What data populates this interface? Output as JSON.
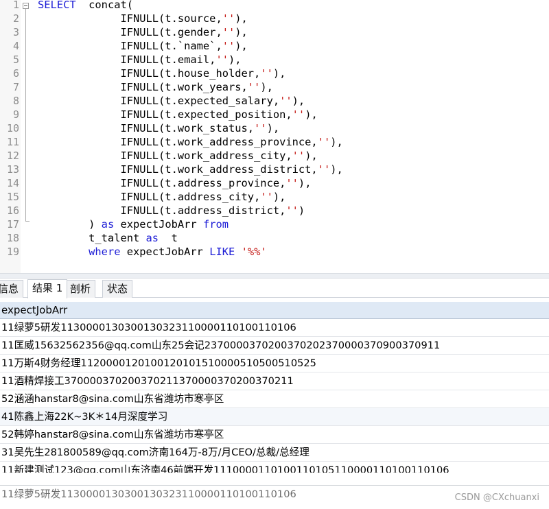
{
  "editor": {
    "lines": [
      {
        "num": "1",
        "segments": [
          {
            "t": "SELECT",
            "c": "kw"
          },
          {
            "t": "  concat(",
            "c": ""
          }
        ]
      },
      {
        "num": "2",
        "segments": [
          {
            "t": "             IFNULL(t.source,",
            "c": ""
          },
          {
            "t": "''",
            "c": "str"
          },
          {
            "t": "),",
            "c": ""
          }
        ]
      },
      {
        "num": "3",
        "segments": [
          {
            "t": "             IFNULL(t.gender,",
            "c": ""
          },
          {
            "t": "''",
            "c": "str"
          },
          {
            "t": "),",
            "c": ""
          }
        ]
      },
      {
        "num": "4",
        "segments": [
          {
            "t": "             IFNULL(t.`name`,",
            "c": ""
          },
          {
            "t": "''",
            "c": "str"
          },
          {
            "t": "),",
            "c": ""
          }
        ]
      },
      {
        "num": "5",
        "segments": [
          {
            "t": "             IFNULL(t.email,",
            "c": ""
          },
          {
            "t": "''",
            "c": "str"
          },
          {
            "t": "),",
            "c": ""
          }
        ]
      },
      {
        "num": "6",
        "segments": [
          {
            "t": "             IFNULL(t.house_holder,",
            "c": ""
          },
          {
            "t": "''",
            "c": "str"
          },
          {
            "t": "),",
            "c": ""
          }
        ]
      },
      {
        "num": "7",
        "segments": [
          {
            "t": "             IFNULL(t.work_years,",
            "c": ""
          },
          {
            "t": "''",
            "c": "str"
          },
          {
            "t": "),",
            "c": ""
          }
        ]
      },
      {
        "num": "8",
        "segments": [
          {
            "t": "             IFNULL(t.expected_salary,",
            "c": ""
          },
          {
            "t": "''",
            "c": "str"
          },
          {
            "t": "),",
            "c": ""
          }
        ]
      },
      {
        "num": "9",
        "segments": [
          {
            "t": "             IFNULL(t.expected_position,",
            "c": ""
          },
          {
            "t": "''",
            "c": "str"
          },
          {
            "t": "),",
            "c": ""
          }
        ]
      },
      {
        "num": "10",
        "segments": [
          {
            "t": "             IFNULL(t.work_status,",
            "c": ""
          },
          {
            "t": "''",
            "c": "str"
          },
          {
            "t": "),",
            "c": ""
          }
        ]
      },
      {
        "num": "11",
        "segments": [
          {
            "t": "             IFNULL(t.work_address_province,",
            "c": ""
          },
          {
            "t": "''",
            "c": "str"
          },
          {
            "t": "),",
            "c": ""
          }
        ]
      },
      {
        "num": "12",
        "segments": [
          {
            "t": "             IFNULL(t.work_address_city,",
            "c": ""
          },
          {
            "t": "''",
            "c": "str"
          },
          {
            "t": "),",
            "c": ""
          }
        ]
      },
      {
        "num": "13",
        "segments": [
          {
            "t": "             IFNULL(t.work_address_district,",
            "c": ""
          },
          {
            "t": "''",
            "c": "str"
          },
          {
            "t": "),",
            "c": ""
          }
        ]
      },
      {
        "num": "14",
        "segments": [
          {
            "t": "             IFNULL(t.address_province,",
            "c": ""
          },
          {
            "t": "''",
            "c": "str"
          },
          {
            "t": "),",
            "c": ""
          }
        ]
      },
      {
        "num": "15",
        "segments": [
          {
            "t": "             IFNULL(t.address_city,",
            "c": ""
          },
          {
            "t": "''",
            "c": "str"
          },
          {
            "t": "),",
            "c": ""
          }
        ]
      },
      {
        "num": "16",
        "segments": [
          {
            "t": "             IFNULL(t.address_district,",
            "c": ""
          },
          {
            "t": "''",
            "c": "str"
          },
          {
            "t": ")",
            "c": ""
          }
        ]
      },
      {
        "num": "17",
        "segments": [
          {
            "t": "        ) ",
            "c": ""
          },
          {
            "t": "as",
            "c": "kw"
          },
          {
            "t": " expectJobArr ",
            "c": ""
          },
          {
            "t": "from",
            "c": "kw"
          }
        ]
      },
      {
        "num": "18",
        "segments": [
          {
            "t": "        t_talent ",
            "c": ""
          },
          {
            "t": "as",
            "c": "kw"
          },
          {
            "t": "  t",
            "c": ""
          }
        ]
      },
      {
        "num": "19",
        "segments": [
          {
            "t": "        ",
            "c": ""
          },
          {
            "t": "where",
            "c": "kw"
          },
          {
            "t": " expectJobArr ",
            "c": ""
          },
          {
            "t": "LIKE",
            "c": "kw"
          },
          {
            "t": " ",
            "c": ""
          },
          {
            "t": "'%%'",
            "c": "str"
          }
        ]
      }
    ]
  },
  "tabs": [
    {
      "label": "信息",
      "active": false
    },
    {
      "label": "结果 1",
      "active": true
    },
    {
      "label": "剖析",
      "active": false
    },
    {
      "label": "状态",
      "active": false
    }
  ],
  "grid": {
    "column": "expectJobArr",
    "rows": [
      "11绿萝5研发11300001303001303231100001101001101​06",
      "11匡威15632562356@qq.com山东25会记2370000370200370202370000370900370911",
      "11万斯4财务经理1120000120100120101510000510500510525",
      "11酒精焊接工370000370200370211370000370200370211",
      "52涵涵hanstar8@sina.com山东省潍坊市寒亭区",
      "41陈鑫上海22K~3K＊14月深度学习",
      "52韩婷hanstar8@sina.com山东省潍坊市寒亭区",
      "31吴先生281800589@qq.com济南164万-8万/月CEO/总裁/总经理",
      "11新建测试123@qq.com山东济南46前端开发1110000110100110105110000110100110106"
    ]
  },
  "valuebar": {
    "current_value": "11绿萝5研发11300001303001303231100001101001101​06",
    "watermark": "CSDN @CXchuanxi"
  },
  "colors": {
    "keyword": "#1c1cd6",
    "string": "#c41a16",
    "header_bg": "#dfe9f5"
  }
}
